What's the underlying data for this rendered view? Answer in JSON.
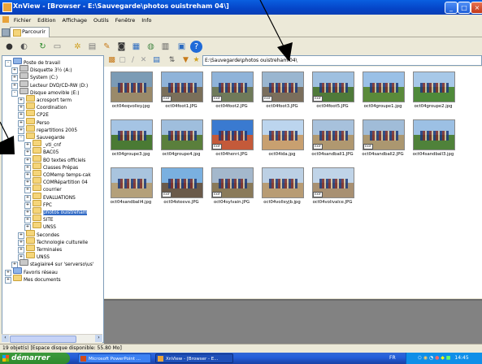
{
  "window": {
    "title": "XnView - [Browser - E:\\Sauvegarde\\photos ouistreham 04\\]",
    "controls": [
      "_",
      "□",
      "×"
    ]
  },
  "menu": [
    "Fichier",
    "Edition",
    "Affichage",
    "Outils",
    "Fenêtre",
    "Info"
  ],
  "tabs": [
    "Parcourir"
  ],
  "path": "E:\\Sauvegarde\\photos ouistreham 04\\",
  "tree": [
    {
      "label": "Poste de travail",
      "level": 0,
      "exp": "-",
      "icon": "pc"
    },
    {
      "label": "Disquette 3½ (A:)",
      "level": 1,
      "exp": "+",
      "icon": "drive"
    },
    {
      "label": "System (C:)",
      "level": 1,
      "exp": "+",
      "icon": "drive"
    },
    {
      "label": "Lecteur DVD/CD-RW (D:)",
      "level": 1,
      "exp": "+",
      "icon": "drive"
    },
    {
      "label": "Disque amovible (E:)",
      "level": 1,
      "exp": "-",
      "icon": "drive"
    },
    {
      "label": "acrosport term",
      "level": 2,
      "exp": "+",
      "icon": "folder"
    },
    {
      "label": "Coordination",
      "level": 2,
      "exp": "+",
      "icon": "folder"
    },
    {
      "label": "CP2E",
      "level": 2,
      "exp": "+",
      "icon": "folder"
    },
    {
      "label": "Perso",
      "level": 2,
      "exp": "+",
      "icon": "folder"
    },
    {
      "label": "repartitions 2005",
      "level": 2,
      "exp": "+",
      "icon": "folder"
    },
    {
      "label": "Sauvegarde",
      "level": 2,
      "exp": "-",
      "icon": "folder"
    },
    {
      "label": "_vti_cnf",
      "level": 3,
      "exp": "+",
      "icon": "folder"
    },
    {
      "label": "BAC05",
      "level": 3,
      "exp": "+",
      "icon": "folder"
    },
    {
      "label": "BO textes officiels",
      "level": 3,
      "exp": "+",
      "icon": "folder"
    },
    {
      "label": "Classes Prépas",
      "level": 3,
      "exp": "+",
      "icon": "folder"
    },
    {
      "label": "COMemp temps-cak",
      "level": 3,
      "exp": "+",
      "icon": "folder"
    },
    {
      "label": "COMRépartition 04",
      "level": 3,
      "exp": "+",
      "icon": "folder"
    },
    {
      "label": "courrier",
      "level": 3,
      "exp": "+",
      "icon": "folder"
    },
    {
      "label": "EVALUATIONS",
      "level": 3,
      "exp": "+",
      "icon": "folder"
    },
    {
      "label": "FPC",
      "level": 3,
      "exp": "+",
      "icon": "folder"
    },
    {
      "label": "photos ouistreham",
      "level": 3,
      "exp": "+",
      "icon": "folder",
      "selected": true
    },
    {
      "label": "SITE",
      "level": 3,
      "exp": "+",
      "icon": "folder"
    },
    {
      "label": "UNSS",
      "level": 3,
      "exp": "+",
      "icon": "folder"
    },
    {
      "label": "Secondes",
      "level": 2,
      "exp": "+",
      "icon": "folder"
    },
    {
      "label": "Technologie culturelle",
      "level": 2,
      "exp": "+",
      "icon": "folder"
    },
    {
      "label": "Terminales",
      "level": 2,
      "exp": "+",
      "icon": "folder"
    },
    {
      "label": "UNSS",
      "level": 2,
      "exp": "+",
      "icon": "folder"
    },
    {
      "label": "stagiaire4 sur 'serverso\\us'",
      "level": 1,
      "exp": "+",
      "icon": "drive"
    },
    {
      "label": "Favoris réseau",
      "level": 0,
      "exp": "+",
      "icon": "pc"
    },
    {
      "label": "Mes documents",
      "level": 0,
      "exp": "+",
      "icon": "folder"
    }
  ],
  "thumbnails": [
    {
      "name": "oct04eqvolley.jpg",
      "sky": "#7b9bb5",
      "ground": "#9a8a6a",
      "badge": false
    },
    {
      "name": "oct04foot1.JPG",
      "sky": "#8fb3d9",
      "ground": "#7a6f5a",
      "badge": true
    },
    {
      "name": "oct04foot2.JPG",
      "sky": "#8fb3d9",
      "ground": "#6f7a5a",
      "badge": true
    },
    {
      "name": "oct04foot3.JPG",
      "sky": "#9ab6d0",
      "ground": "#7a6e5c",
      "badge": true
    },
    {
      "name": "oct04foot5.JPG",
      "sky": "#9fc0e0",
      "ground": "#4f7a3a",
      "badge": true
    },
    {
      "name": "oct04groupe1.jpg",
      "sky": "#9ac0e6",
      "ground": "#5a8a3a",
      "badge": false
    },
    {
      "name": "oct04groupe2.jpg",
      "sky": "#a7c8e8",
      "ground": "#4f8a3a",
      "badge": false
    },
    {
      "name": "oct04groupe3.jpg",
      "sky": "#a5c4e4",
      "ground": "#4a7a34",
      "badge": false
    },
    {
      "name": "oct04groupe4.jpg",
      "sky": "#9fbedd",
      "ground": "#5a7f3c",
      "badge": false
    },
    {
      "name": "oct04henri.JPG",
      "sky": "#3a7ad0",
      "ground": "#c45a3a",
      "badge": true
    },
    {
      "name": "oct04ida.jpg",
      "sky": "#bcd5ee",
      "ground": "#c8a070",
      "badge": false
    },
    {
      "name": "oct04sandball1.JPG",
      "sky": "#a7c1dc",
      "ground": "#b09870",
      "badge": true
    },
    {
      "name": "oct04sandball2.JPG",
      "sky": "#a0bcd8",
      "ground": "#ab9770",
      "badge": true
    },
    {
      "name": "oct04sandball3.jpg",
      "sky": "#9cc0e4",
      "ground": "#4f823a",
      "badge": false
    },
    {
      "name": "oct04sandball4.jpg",
      "sky": "#a9c4de",
      "ground": "#b4a07a",
      "badge": false
    },
    {
      "name": "oct04steeve.JPG",
      "sky": "#7ab0e0",
      "ground": "#6a5a4a",
      "badge": true
    },
    {
      "name": "oct04sylvain.JPG",
      "sky": "#a4b8cc",
      "ground": "#8a7a5a",
      "badge": true
    },
    {
      "name": "oct04volleyjb.jpg",
      "sky": "#bcd0e4",
      "ground": "#b89c74",
      "badge": false
    },
    {
      "name": "oct04volivalce.JPG",
      "sky": "#c0d4e8",
      "ground": "#a89072",
      "badge": true
    }
  ],
  "status": "19 objet(s) [Espace disque disponible: 55.80 Mo]",
  "taskbar": {
    "start": "démarrer",
    "tasks": [
      "Microsoft PowerPoint ...",
      "XnView - [Browser - E..."
    ],
    "lang": "FR",
    "clock": "14:45"
  },
  "exif_badge": "EXIF"
}
